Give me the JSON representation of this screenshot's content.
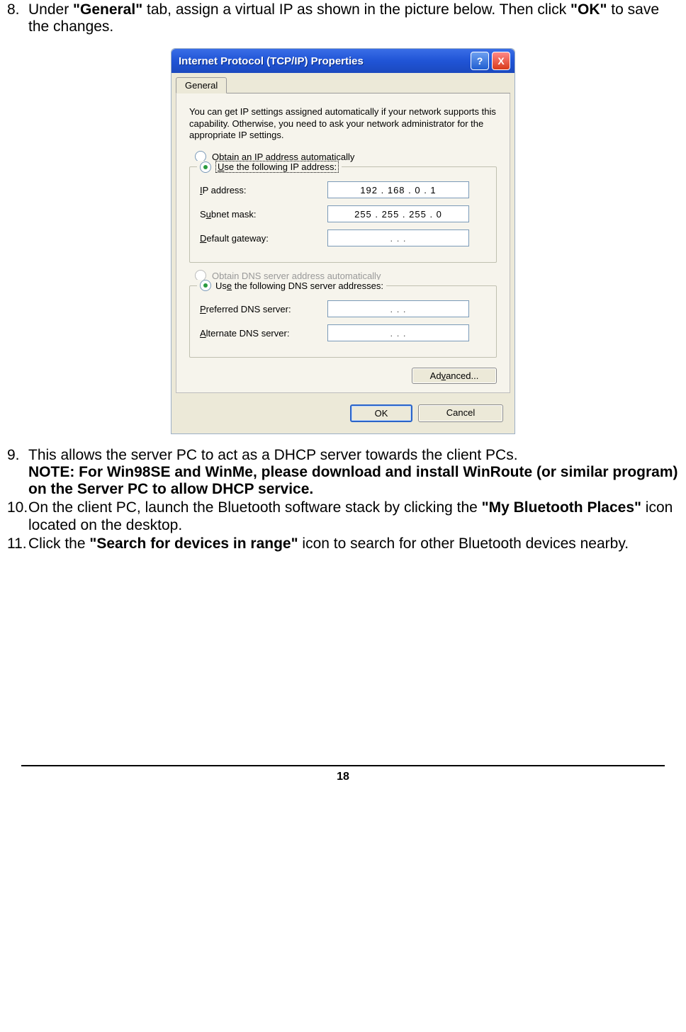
{
  "steps": {
    "s8": {
      "num": "8.",
      "pre": "Under ",
      "b1": "\"General\"",
      "mid": " tab, assign a virtual IP as shown in the picture below. Then click ",
      "b2": "\"OK\"",
      "post": " to save the changes."
    },
    "s9": {
      "num": "9.",
      "line1": "This allows the server PC to act as a DHCP server towards the client PCs.",
      "note": "NOTE: For Win98SE and WinMe, please download and install WinRoute (or similar program) on the Server PC to allow DHCP service."
    },
    "s10": {
      "num": "10.",
      "pre": "On the client PC, launch the Bluetooth software stack by clicking the ",
      "b1": "\"My Bluetooth Places\"",
      "post": " icon located on the desktop."
    },
    "s11": {
      "num": "11.",
      "pre": "Click the ",
      "b1": "\"Search for devices in range\"",
      "post": " icon to search for other Bluetooth devices nearby."
    }
  },
  "dialog": {
    "title": "Internet Protocol (TCP/IP) Properties",
    "help": "?",
    "close": "X",
    "tab": "General",
    "desc": "You can get IP settings assigned automatically if your network supports this capability. Otherwise, you need to ask your network administrator for the appropriate IP settings.",
    "radio_auto_ip": "Obtain an IP address automatically",
    "radio_use_ip": "Use the following IP address:",
    "ip_label": "IP address:",
    "ip_value": "192 . 168 .  0  .  1",
    "subnet_label": "Subnet mask:",
    "subnet_value": "255 . 255 . 255 .  0",
    "gateway_label": "Default gateway:",
    "gateway_value": ".       .       .",
    "radio_auto_dns": "Obtain DNS server address automatically",
    "radio_use_dns": "Use the following DNS server addresses:",
    "pref_dns_label": "Preferred DNS server:",
    "pref_dns_value": ".       .       .",
    "alt_dns_label": "Alternate DNS server:",
    "alt_dns_value": ".       .       .",
    "advanced": "Advanced...",
    "ok": "OK",
    "cancel": "Cancel",
    "underline": {
      "O": "O",
      "U": "U",
      "I": "I",
      "S": "S",
      "D": "D",
      "b": "b",
      "e": "e",
      "P": "P",
      "A": "A",
      "v": "v"
    }
  },
  "page_number": "18"
}
